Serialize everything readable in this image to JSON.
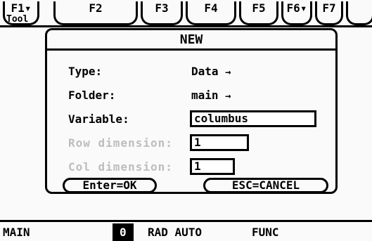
{
  "toolbar": {
    "tabs": [
      {
        "label": "F1▾",
        "sub": "Tool"
      },
      {
        "label": "F2"
      },
      {
        "label": "F3"
      },
      {
        "label": "F4"
      },
      {
        "label": "F5"
      },
      {
        "label": "F6▾"
      },
      {
        "label": "F7"
      }
    ]
  },
  "dialog": {
    "title": "NEW",
    "type": {
      "label": "Type:",
      "value": "Data",
      "arrow": "→"
    },
    "folder": {
      "label": "Folder:",
      "value": "main",
      "arrow": "→"
    },
    "variable": {
      "label": "Variable:",
      "value": "columbus"
    },
    "row_dimension": {
      "label": "Row dimension:",
      "value": "1"
    },
    "col_dimension": {
      "label": "Col dimension:",
      "value": "1"
    },
    "ok_button": "Enter=OK",
    "cancel_button": "ESC=CANCEL"
  },
  "status_bar": {
    "mode": "MAIN",
    "indicator": "0",
    "angle_mode": "RAD AUTO",
    "graph_mode": "FUNC"
  },
  "colors": {
    "lcd_background": "#fafafa",
    "ink": "#000000",
    "disabled_text": "#bdbdbd"
  }
}
